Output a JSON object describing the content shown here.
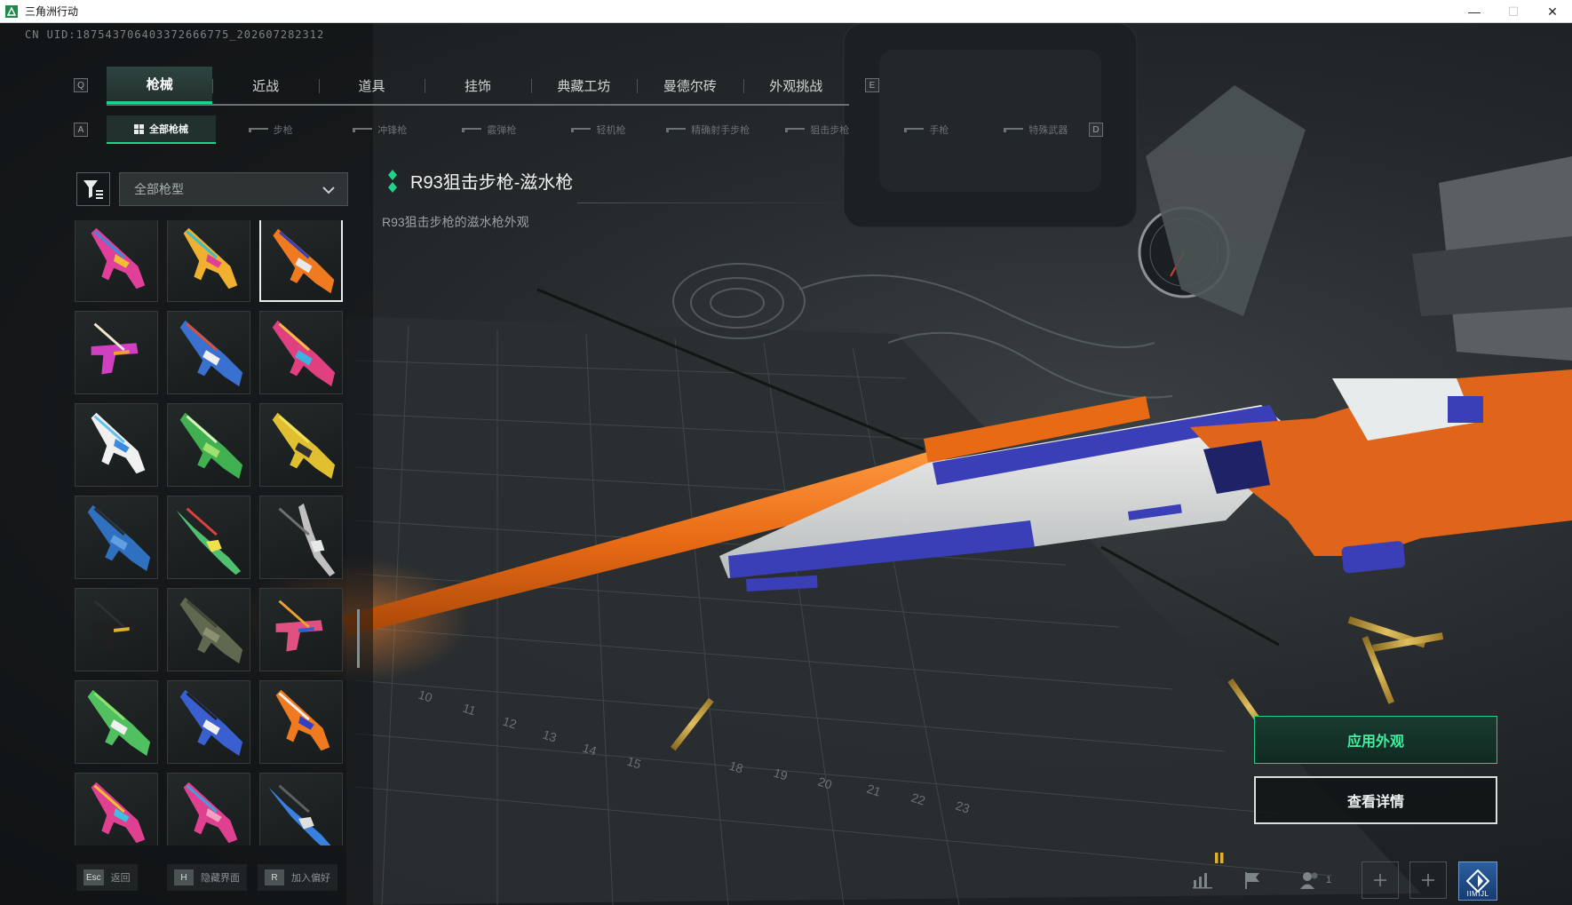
{
  "window": {
    "title": "三角洲行动",
    "controls": [
      "—",
      "☐",
      "✕"
    ]
  },
  "uid_text": "CN UID:1875437064033726667​75_202607282312",
  "keys": {
    "main_prev": "Q",
    "main_next": "E",
    "sub_prev": "A",
    "sub_next": "D"
  },
  "main_tabs": [
    {
      "label": "枪械",
      "active": true
    },
    {
      "label": "近战",
      "active": false
    },
    {
      "label": "道具",
      "active": false
    },
    {
      "label": "挂饰",
      "active": false
    },
    {
      "label": "典藏工坊",
      "active": false
    },
    {
      "label": "曼德尔砖",
      "active": false
    },
    {
      "label": "外观挑战",
      "active": false
    }
  ],
  "sub_tabs": [
    {
      "label": "全部枪械",
      "active": true
    },
    {
      "label": "步枪",
      "active": false
    },
    {
      "label": "冲锋枪",
      "active": false
    },
    {
      "label": "霰弹枪",
      "active": false
    },
    {
      "label": "轻机枪",
      "active": false
    },
    {
      "label": "精确射手步枪",
      "active": false
    },
    {
      "label": "狙击步枪",
      "active": false
    },
    {
      "label": "手枪",
      "active": false
    },
    {
      "label": "特殊武器",
      "active": false
    }
  ],
  "filter": {
    "selected": "全部枪型"
  },
  "weapon": {
    "name": "R93狙击步枪-滋水枪",
    "description": "R93狙击步枪的滋水枪外观"
  },
  "weapon_skins": [
    {
      "shape": "smg",
      "colors": [
        "#e0409a",
        "#f0c030",
        "#3a8adf"
      ]
    },
    {
      "shape": "smg",
      "colors": [
        "#f0b030",
        "#e04090",
        "#30c0d0"
      ]
    },
    {
      "shape": "rifle",
      "colors": [
        "#f07a20",
        "#e8e8e8",
        "#3040c0"
      ],
      "selected": true
    },
    {
      "shape": "pistol",
      "colors": [
        "#d040c0",
        "#f0a030",
        "#f2e8d0"
      ]
    },
    {
      "shape": "rifle",
      "colors": [
        "#3a70d0",
        "#f0f0f0",
        "#e05030"
      ]
    },
    {
      "shape": "rifle",
      "colors": [
        "#e04080",
        "#40b0e0",
        "#f0c040"
      ]
    },
    {
      "shape": "smg",
      "colors": [
        "#f0f0f0",
        "#3a8ae0",
        "#60c0f0"
      ]
    },
    {
      "shape": "rifle",
      "colors": [
        "#40b050",
        "#a0e070",
        "#e0f0c0"
      ]
    },
    {
      "shape": "rifle",
      "colors": [
        "#e0c030",
        "#303030",
        "#f0e060"
      ]
    },
    {
      "shape": "rifle",
      "colors": [
        "#3070c0",
        "#60a0e0",
        "#2a2a2a"
      ]
    },
    {
      "shape": "sniper",
      "colors": [
        "#50c070",
        "#f0e050",
        "#e04040"
      ]
    },
    {
      "shape": "shotgun",
      "colors": [
        "#c0c0c0",
        "#e8e8e8",
        "#707070"
      ]
    },
    {
      "shape": "pistol",
      "colors": [
        "#202020",
        "#e0b030",
        "#303030"
      ]
    },
    {
      "shape": "rifle",
      "colors": [
        "#606850",
        "#8a9070",
        "#404838"
      ]
    },
    {
      "shape": "pistol",
      "colors": [
        "#e05080",
        "#3060d0",
        "#f0a030"
      ]
    },
    {
      "shape": "rifle",
      "colors": [
        "#50c060",
        "#f0f0f0",
        "#90e070"
      ]
    },
    {
      "shape": "rifle",
      "colors": [
        "#3a5fd0",
        "#f0f0f0",
        "#202020"
      ]
    },
    {
      "shape": "smg",
      "colors": [
        "#f07a20",
        "#3040c0",
        "#f0f0f0"
      ]
    },
    {
      "shape": "smg",
      "colors": [
        "#e04090",
        "#40c0e0",
        "#f0c030"
      ]
    },
    {
      "shape": "smg",
      "colors": [
        "#e04090",
        "#f0a0c0",
        "#40a0e0"
      ]
    },
    {
      "shape": "sniper",
      "colors": [
        "#3a80e0",
        "#e0e0e0",
        "#606060"
      ]
    }
  ],
  "buttons": {
    "apply": "应用外观",
    "details": "查看详情"
  },
  "bottom_hints": [
    {
      "key": "Esc",
      "label": "返回"
    },
    {
      "key": "H",
      "label": "隐藏界面"
    },
    {
      "key": "R",
      "label": "加入偏好"
    }
  ],
  "tray": {
    "friends_count": "1",
    "logo_label": "IIMIJL"
  },
  "colors": {
    "accent": "#22d28a",
    "skin_orange": "#f07a20",
    "skin_blue": "#3a3fb8"
  }
}
